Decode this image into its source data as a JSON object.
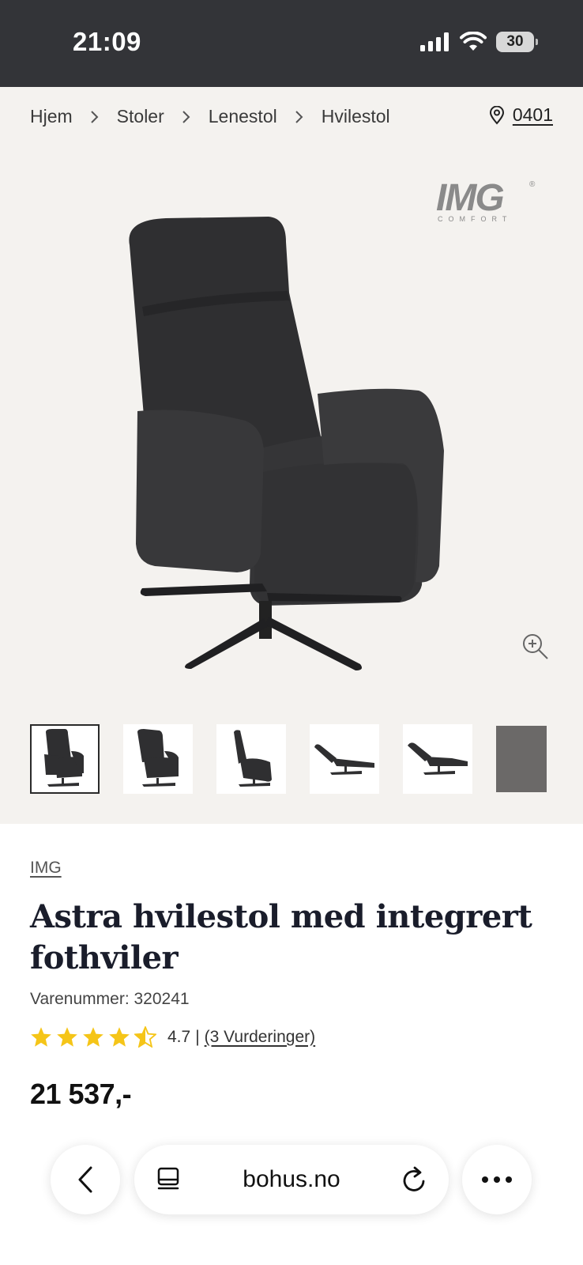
{
  "status_bar": {
    "time": "21:09",
    "battery": "30"
  },
  "breadcrumb": {
    "items": [
      "Hjem",
      "Stoler",
      "Lenestol",
      "Hvilestol"
    ],
    "postal_code": "0401"
  },
  "gallery": {
    "brand_logo": {
      "text": "IMG",
      "subtext": "COMFORT"
    },
    "thumbnail_count": 6,
    "active_thumbnail": 0
  },
  "product": {
    "brand": "IMG",
    "title": "Astra hvilestol med integrert fothviler",
    "sku": "Varenummer: 320241",
    "rating": {
      "value": "4.7",
      "stars": 4.5,
      "separator": "|",
      "reviews_label": "(3 Vurderinger)"
    },
    "price": "21 537,-"
  },
  "browser": {
    "url": "bohus.no"
  },
  "colors": {
    "status_bar": "#333438",
    "hero_bg": "#f4f2ef",
    "star": "#f5c518",
    "chair": "#2f2f31"
  }
}
